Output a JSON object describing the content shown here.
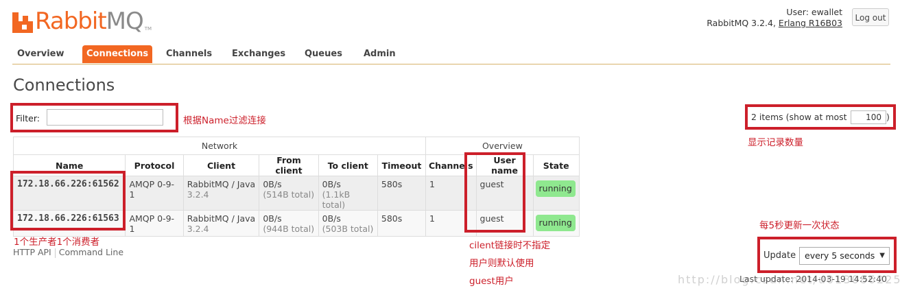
{
  "app": {
    "logo_rabbit": "Rabbit",
    "logo_mq": "MQ",
    "logo_tm": "TM"
  },
  "header": {
    "user_label": "User: ewallet",
    "version_prefix": "RabbitMQ 3.2.4, ",
    "erlang": "Erlang R16B03",
    "logout_label": "Log out"
  },
  "nav": {
    "tabs": [
      {
        "label": "Overview"
      },
      {
        "label": "Connections",
        "active": true
      },
      {
        "label": "Channels"
      },
      {
        "label": "Exchanges"
      },
      {
        "label": "Queues"
      },
      {
        "label": "Admin"
      }
    ]
  },
  "page": {
    "title": "Connections"
  },
  "filter": {
    "label": "Filter:",
    "value": ""
  },
  "items": {
    "text": "2 items (show at most",
    "value": "100",
    "close": ")"
  },
  "table": {
    "groups": {
      "network": "Network",
      "overview": "Overview"
    },
    "columns": [
      "Name",
      "Protocol",
      "Client",
      "From client",
      "To client",
      "Timeout",
      "Channels",
      "User name",
      "State"
    ],
    "rows": [
      {
        "name": "172.18.66.226:61562",
        "protocol": "AMQP 0-9-1",
        "client": "RabbitMQ / Java",
        "client_ver": "3.2.4",
        "from": "0B/s",
        "from_total": "(514B total)",
        "to": "0B/s",
        "to_total": "(1.1kB total)",
        "timeout": "580s",
        "channels": "1",
        "user": "guest",
        "state": "running"
      },
      {
        "name": "172.18.66.226:61563",
        "protocol": "AMQP 0-9-1",
        "client": "RabbitMQ / Java",
        "client_ver": "3.2.4",
        "from": "0B/s",
        "from_total": "(944B total)",
        "to": "0B/s",
        "to_total": "(503B total)",
        "timeout": "580s",
        "channels": "1",
        "user": "guest",
        "state": "running"
      }
    ]
  },
  "footer": {
    "http_api": "HTTP API",
    "command_line": "Command Line"
  },
  "update": {
    "label": "Update",
    "selected": "every 5 seconds",
    "last_update": "Last update: 2014-03-19 14:52:40"
  },
  "annotations": {
    "filter_note": "根据Name过滤连接",
    "items_note": "显示记录数量",
    "name_note": "1个生产者1个消费者",
    "user_note_1": "cilent链接时不指定",
    "user_note_2": "用户则默认使用",
    "user_note_3": "guest用户",
    "update_note": "每5秒更新一次状态"
  },
  "watermark": "http://blog.csdn.net/u013086225",
  "colors": {
    "accent": "#f26722",
    "annotation": "#cc1f2a",
    "running": "#8fe88f"
  }
}
